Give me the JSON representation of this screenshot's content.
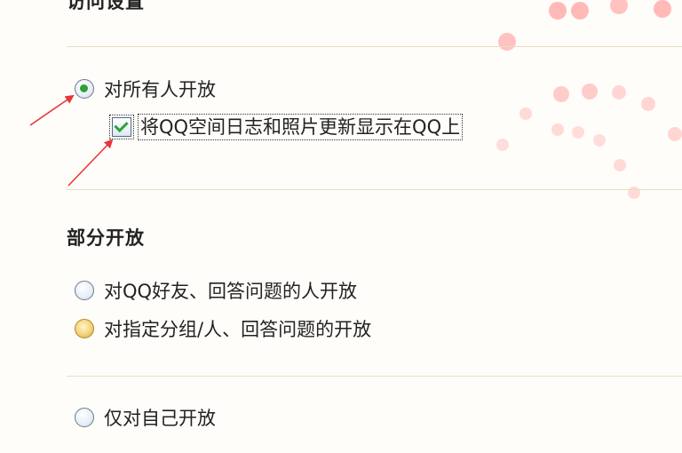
{
  "section_top": {
    "title": "访问设置"
  },
  "open_to_all": {
    "label": "对所有人开放",
    "checked": true,
    "sync_checkbox": {
      "label": "将QQ空间日志和照片更新显示在QQ上",
      "checked": true
    }
  },
  "partial": {
    "title": "部分开放",
    "options": [
      {
        "label": "对QQ好友、回答问题的人开放",
        "checked": false
      },
      {
        "label": "对指定分组/人、回答问题的开放",
        "checked": false
      }
    ]
  },
  "private": {
    "label": "仅对自己开放",
    "checked": false
  },
  "colors": {
    "accent_red": "#e8363a",
    "divider": "#eadbc6",
    "check_green": "#2fa13a"
  },
  "icons": [
    "red-arrow-icon",
    "radio-checked-icon",
    "checkbox-checked-icon"
  ]
}
